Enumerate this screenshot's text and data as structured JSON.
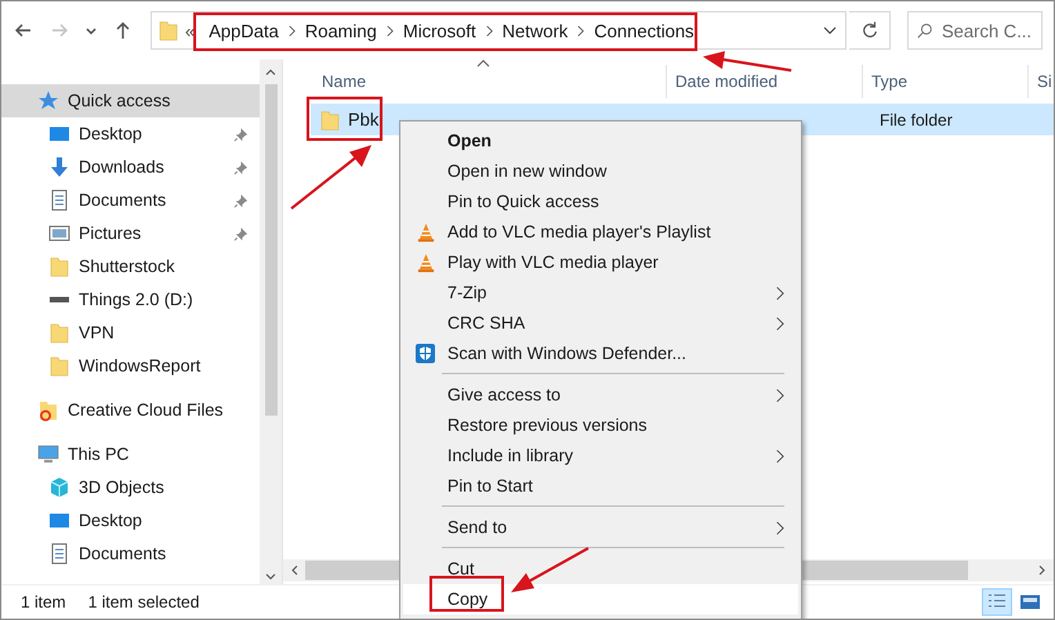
{
  "nav_buttons": [
    {
      "kind": "back",
      "disabled": false
    },
    {
      "kind": "forward",
      "disabled": true
    },
    {
      "kind": "recent",
      "disabled": false
    },
    {
      "kind": "up",
      "disabled": false
    }
  ],
  "address": {
    "overflow": "«",
    "segments": [
      "AppData",
      "Roaming",
      "Microsoft",
      "Network",
      "Connections"
    ]
  },
  "search": {
    "placeholder": "Search C..."
  },
  "sidebar": {
    "items": [
      {
        "label": "Quick access",
        "kind": "star",
        "selected": true,
        "children": [
          {
            "label": "Desktop",
            "kind": "desktop",
            "pinned": true
          },
          {
            "label": "Downloads",
            "kind": "download",
            "pinned": true
          },
          {
            "label": "Documents",
            "kind": "document",
            "pinned": true
          },
          {
            "label": "Pictures",
            "kind": "pictures",
            "pinned": true
          },
          {
            "label": "Shutterstock",
            "kind": "folder",
            "pinned": false
          },
          {
            "label": "Things 2.0 (D:)",
            "kind": "drive",
            "pinned": false
          },
          {
            "label": "VPN",
            "kind": "folder",
            "pinned": false
          },
          {
            "label": "WindowsReport",
            "kind": "folder",
            "pinned": false
          }
        ]
      },
      {
        "label": "Creative Cloud Files",
        "kind": "cloudfolder",
        "selected": false
      },
      {
        "label": "This PC",
        "kind": "pc",
        "selected": false,
        "children": [
          {
            "label": "3D Objects",
            "kind": "cube",
            "pinned": false
          },
          {
            "label": "Desktop",
            "kind": "desktop",
            "pinned": false
          },
          {
            "label": "Documents",
            "kind": "document",
            "pinned": false
          }
        ]
      }
    ]
  },
  "columns": [
    "Name",
    "Date modified",
    "Type",
    "Si"
  ],
  "files": [
    {
      "name": "Pbk",
      "type": "File folder",
      "selected": true
    }
  ],
  "context_menu": [
    {
      "kind": "plain",
      "label": "Open",
      "default": true,
      "submenu": false
    },
    {
      "kind": "plain",
      "label": "Open in new window",
      "default": false,
      "submenu": false
    },
    {
      "kind": "plain",
      "label": "Pin to Quick access",
      "default": false,
      "submenu": false
    },
    {
      "kind": "cone",
      "label": "Add to VLC media player's Playlist",
      "default": false,
      "submenu": false
    },
    {
      "kind": "cone",
      "label": "Play with VLC media player",
      "default": false,
      "submenu": false
    },
    {
      "kind": "plain",
      "label": "7-Zip",
      "default": false,
      "submenu": true
    },
    {
      "kind": "plain",
      "label": "CRC SHA",
      "default": false,
      "submenu": true
    },
    {
      "kind": "shield",
      "label": "Scan with Windows Defender...",
      "default": false,
      "submenu": false
    },
    {
      "kind": "separator"
    },
    {
      "kind": "plain",
      "label": "Give access to",
      "default": false,
      "submenu": true
    },
    {
      "kind": "plain",
      "label": "Restore previous versions",
      "default": false,
      "submenu": false
    },
    {
      "kind": "plain",
      "label": "Include in library",
      "default": false,
      "submenu": true
    },
    {
      "kind": "plain",
      "label": "Pin to Start",
      "default": false,
      "submenu": false
    },
    {
      "kind": "separator"
    },
    {
      "kind": "plain",
      "label": "Send to",
      "default": false,
      "submenu": true
    },
    {
      "kind": "separator"
    },
    {
      "kind": "plain",
      "label": "Cut",
      "default": false,
      "submenu": false,
      "selected": false
    },
    {
      "kind": "plain",
      "label": "Copy",
      "default": false,
      "submenu": false,
      "selected": true
    }
  ],
  "status_bar": {
    "count": "1 item",
    "selection": "1 item selected"
  },
  "views": [
    {
      "kind": "details",
      "selected": true
    },
    {
      "kind": "tiles",
      "selected": false
    }
  ]
}
